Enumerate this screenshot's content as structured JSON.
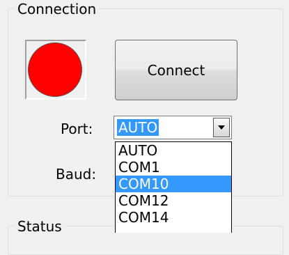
{
  "connection_group": {
    "title": "Connection"
  },
  "led": {
    "state_color": "#ff0000"
  },
  "connect_button": {
    "label": "Connect"
  },
  "port": {
    "label": "Port:",
    "selected_value": "AUTO",
    "options": [
      "AUTO",
      "COM1",
      "COM10",
      "COM12",
      "COM14"
    ],
    "highlighted_index": 2
  },
  "baud": {
    "label": "Baud:"
  },
  "status_group": {
    "title": "Status"
  },
  "icons": {
    "dropdown_arrow": "chevron-down-icon"
  },
  "colors": {
    "selection": "#3399ff",
    "led_off": "#ff0000"
  }
}
